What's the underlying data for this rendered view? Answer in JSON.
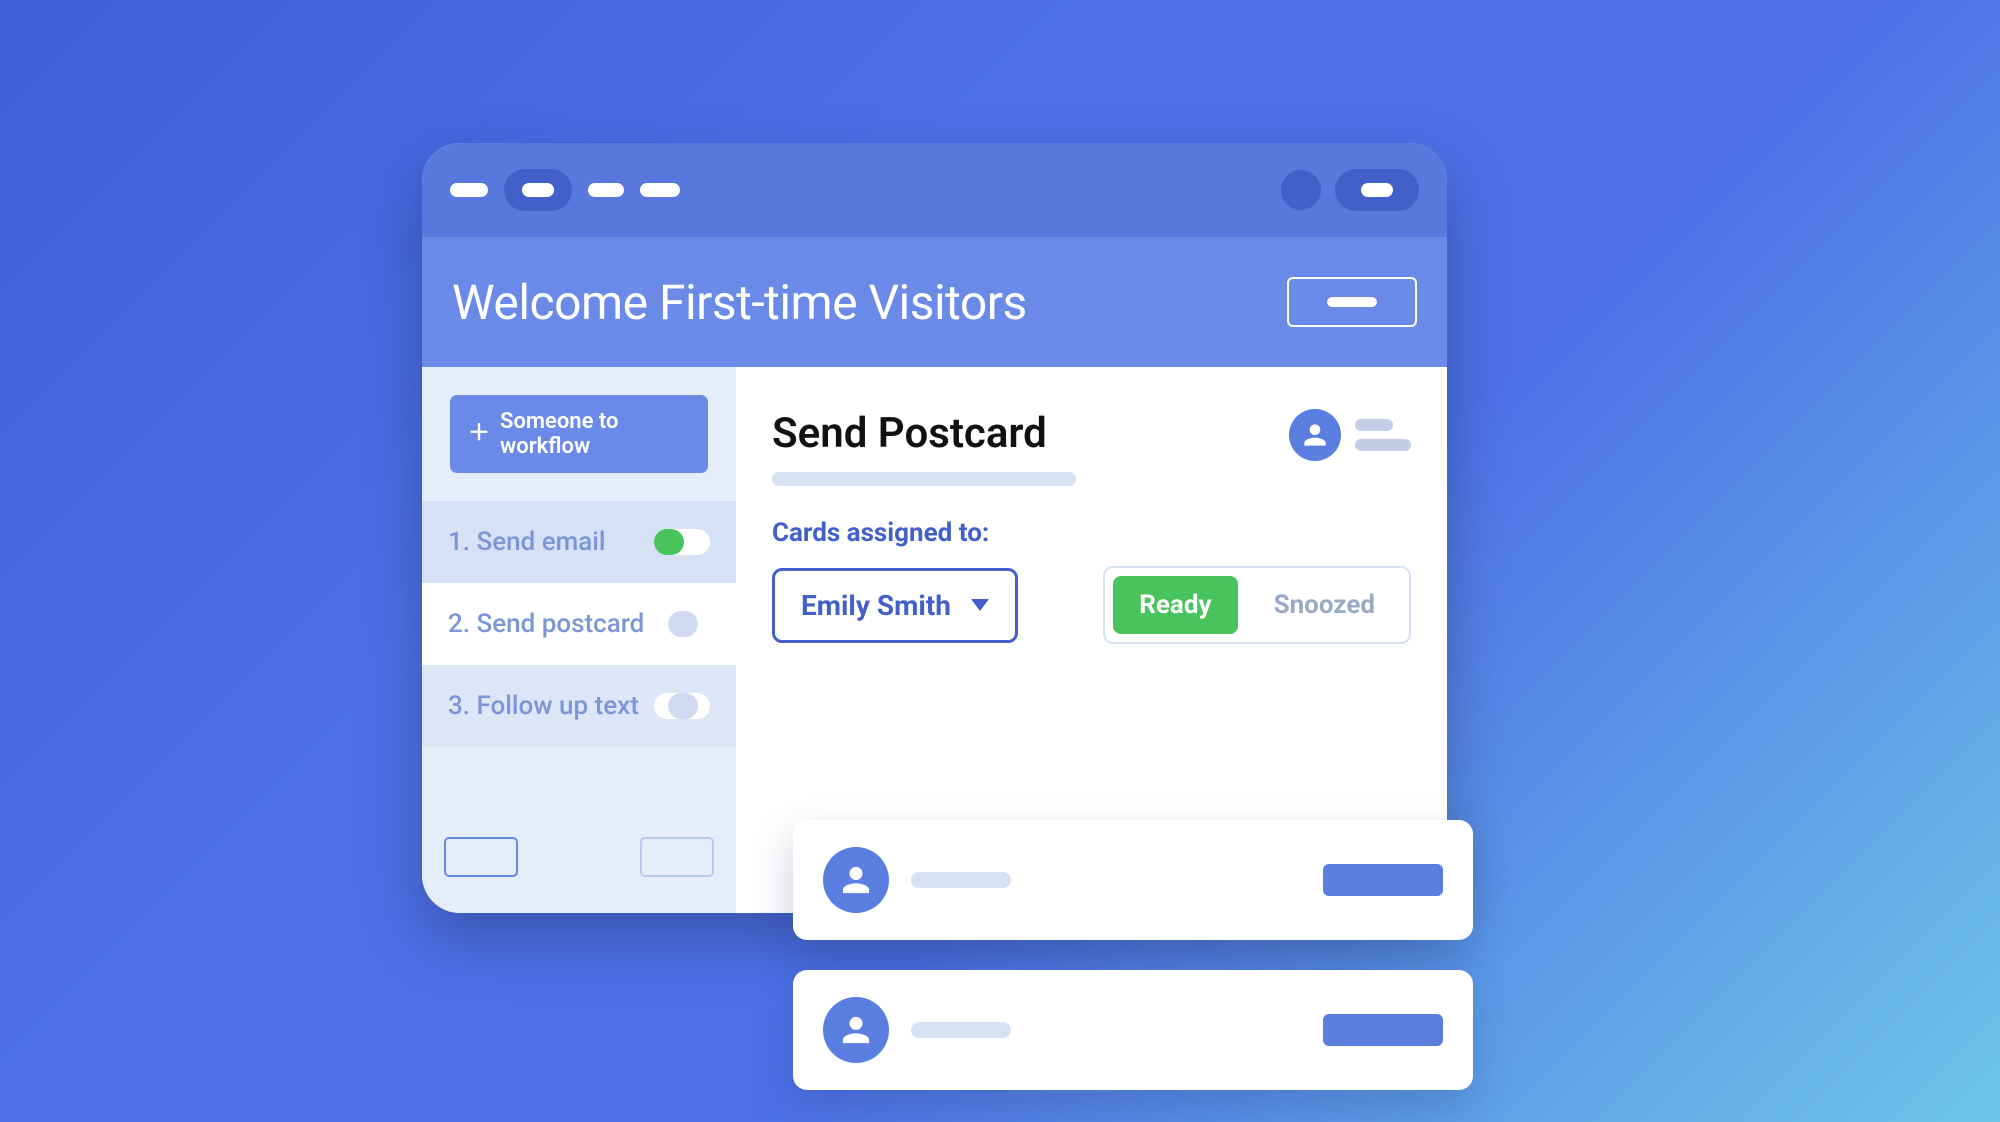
{
  "page_title": "Welcome First-time Visitors",
  "sidebar": {
    "add_button_label": "Someone  to workflow",
    "steps": [
      {
        "label": "1. Send email",
        "toggle_on": true
      },
      {
        "label": "2. Send postcard",
        "toggle_on": false
      },
      {
        "label": "3. Follow up text",
        "toggle_on": false
      }
    ]
  },
  "main": {
    "heading": "Send Postcard",
    "assign_label": "Cards assigned to:",
    "assignee": "Emily Smith",
    "tabs": {
      "ready": "Ready",
      "snoozed": "Snoozed"
    }
  }
}
